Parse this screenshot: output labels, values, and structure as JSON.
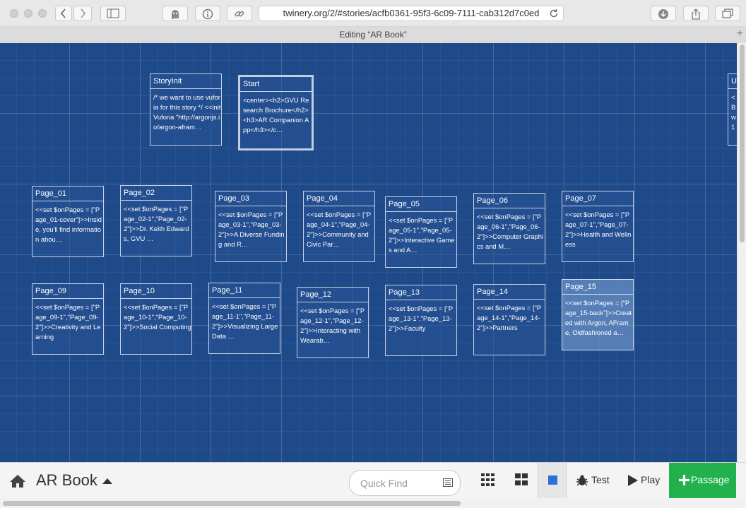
{
  "browser": {
    "url": "twinery.org/2/#stories/acfb0361-95f3-6c09-7111-cab312d7c0ed",
    "tab_title": "Editing “AR Book”",
    "new_tab_label": "+"
  },
  "passages": [
    {
      "title": "StoryInit",
      "excerpt": "/* we want to use vuforia for this story */ <<initVuforia \"http://argonjs.io/argon-afram…"
    },
    {
      "title": "Start",
      "excerpt": "<center><h2>GVU Research Brochure</h2> <h3>AR Companion App</h3></c…"
    },
    {
      "title": "U",
      "excerpt": "<\nB\nw\n1"
    },
    {
      "title": "Page_01",
      "excerpt": "<<set $onPages = [\"Page_01-cover\"]>>Inside, you'll find information abou…"
    },
    {
      "title": "Page_02",
      "excerpt": "<<set $onPages = [\"Page_02-1\",\"Page_02-2\"]>>Dr. Keith Edwards, GVU …"
    },
    {
      "title": "Page_03",
      "excerpt": "<<set $onPages = [\"Page_03-1\",\"Page_03-2\"]>>A Diverse Funding and R…"
    },
    {
      "title": "Page_04",
      "excerpt": "<<set $onPages = [\"Page_04-1\",\"Page_04-2\"]>>Community and Civic Par…"
    },
    {
      "title": "Page_05",
      "excerpt": "<<set $onPages = [\"Page_05-1\",\"Page_05-2\"]>>Interactive Games and A…"
    },
    {
      "title": "Page_06",
      "excerpt": "<<set $onPages = [\"Page_06-1\",\"Page_06-2\"]>>Computer Graphics and M…"
    },
    {
      "title": "Page_07",
      "excerpt": "<<set $onPages = [\"Page_07-1\",\"Page_07-2\"]>>Health and Wellness"
    },
    {
      "title": "Page_09",
      "excerpt": "<<set $onPages = [\"Page_09-1\",\"Page_09-2\"]>>Creativity and Learning"
    },
    {
      "title": "Page_10",
      "excerpt": "<<set $onPages = [\"Page_10-1\",\"Page_10-2\"]>>Social Computing"
    },
    {
      "title": "Page_11",
      "excerpt": "<<set $onPages = [\"Page_11-1\",\"Page_11-2\"]>>Visualizing Large Data …"
    },
    {
      "title": "Page_12",
      "excerpt": "<<set $onPages = [\"Page_12-1\",\"Page_12-2\"]>>Interacting with Wearab…"
    },
    {
      "title": "Page_13",
      "excerpt": "<<set $onPages = [\"Page_13-1\",\"Page_13-2\"]>>Faculty"
    },
    {
      "title": "Page_14",
      "excerpt": "<<set $onPages = [\"Page_14-1\",\"Page_14-2\"]>>Partners"
    },
    {
      "title": "Page_15",
      "excerpt": "<<set $onPages = [\"Page_15-back\"]>>Created with Argon, AFrame, Oldfashioned a…"
    }
  ],
  "footer": {
    "story_title": "AR Book",
    "quick_find_placeholder": "Quick Find",
    "test_label": "Test",
    "play_label": "Play",
    "passage_label": "Passage"
  }
}
